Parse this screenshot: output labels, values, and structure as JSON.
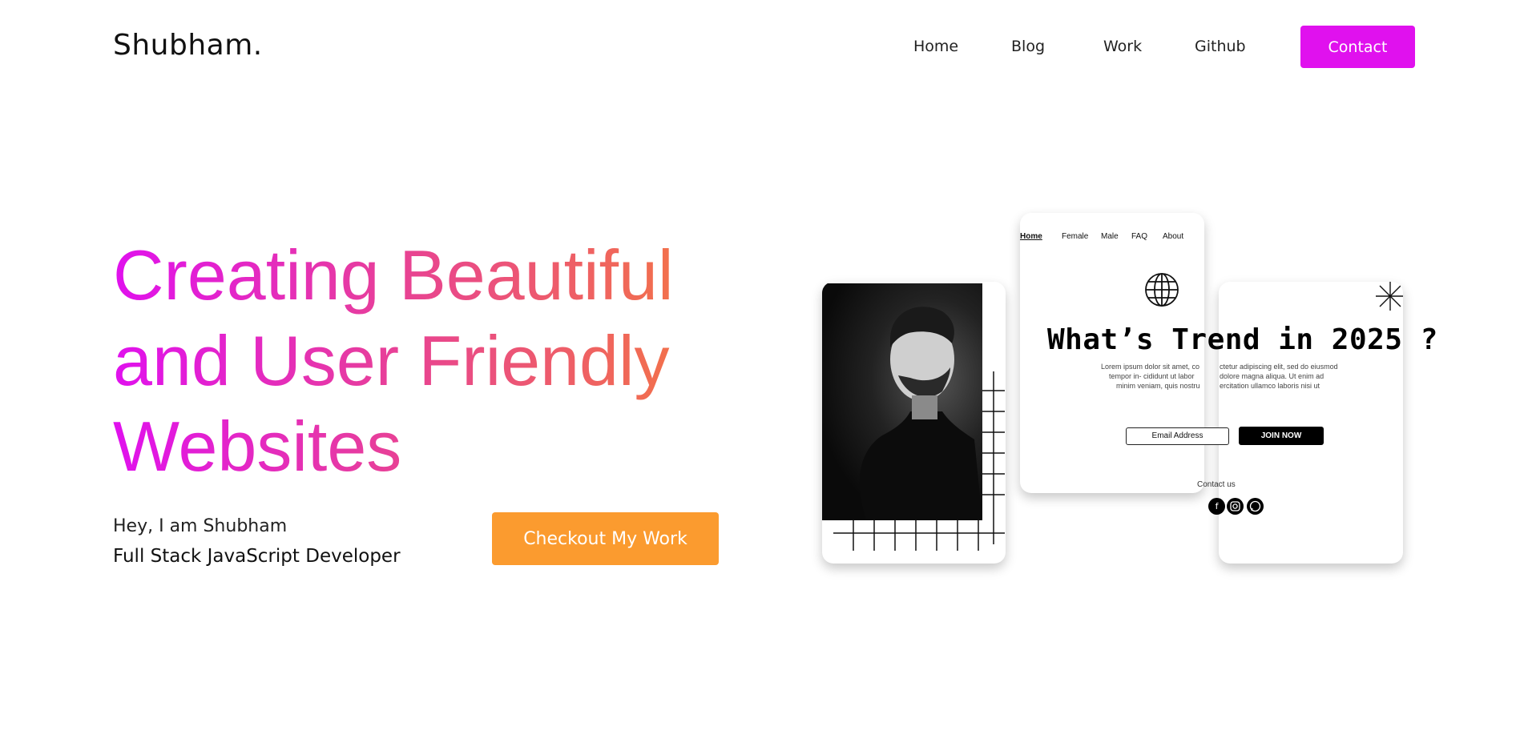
{
  "header": {
    "logo": "Shubham.",
    "nav": [
      {
        "label": "Home"
      },
      {
        "label": "Blog"
      },
      {
        "label": "Work"
      },
      {
        "label": "Github"
      }
    ],
    "contact_label": "Contact"
  },
  "hero": {
    "title_lines": [
      "Creating Beautiful",
      "and User Friendly",
      "Websites"
    ],
    "greeting": "Hey, I am Shubham",
    "role": "Full Stack JavaScript Developer",
    "cta_label": "Checkout My Work"
  },
  "preview": {
    "mini_nav": [
      "Home",
      "Female",
      "Male",
      "FAQ",
      "About"
    ],
    "headline": "What’s Trend in 2025 ?",
    "lorem_left": [
      "Lorem ipsum dolor sit amet, co",
      "tempor in- cididunt ut labor",
      "minim veniam, quis nostru"
    ],
    "lorem_right": [
      "ctetur adipiscing elit, sed do eiusmod",
      "dolore magna aliqua. Ut enim ad",
      "ercitation ullamco laboris nisi ut"
    ],
    "email_placeholder": "Email Address",
    "join_label": "JOIN NOW",
    "contact_us": "Contact us"
  },
  "colors": {
    "brand_magenta": "#e011ee",
    "cta_orange": "#fb9b2f",
    "gradient_end": "#f58a36"
  }
}
